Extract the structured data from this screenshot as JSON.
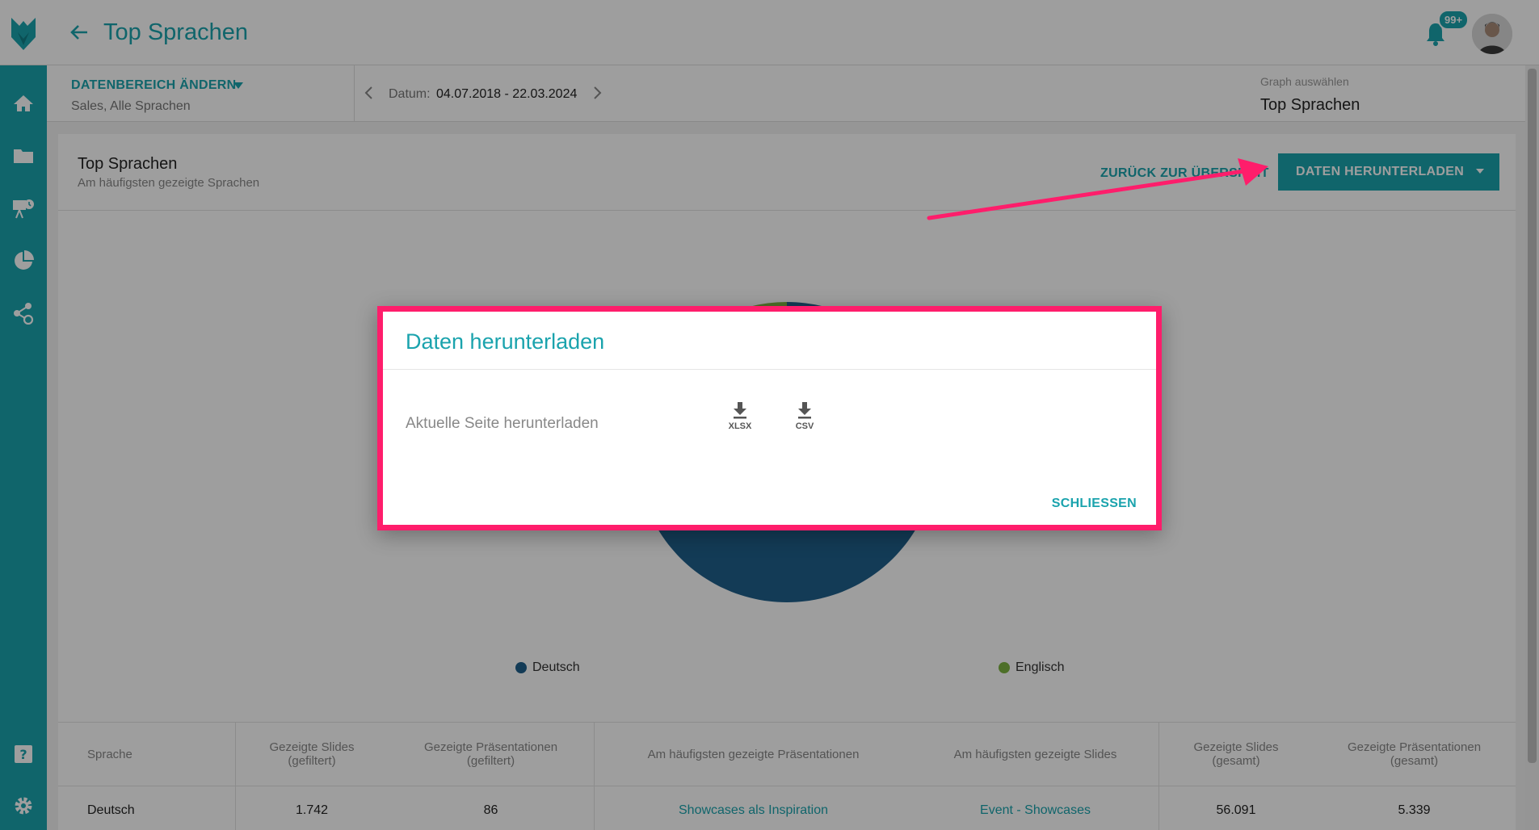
{
  "header": {
    "title": "Top Sprachen",
    "notification_count": "99+"
  },
  "filter": {
    "range_label": "DATENBEREICH ÄNDERN",
    "range_sub": "Sales, Alle Sprachen",
    "date_label": "Datum:",
    "date_value": "04.07.2018 - 22.03.2024",
    "graph_label": "Graph auswählen",
    "graph_value": "Top Sprachen"
  },
  "card": {
    "title": "Top Sprachen",
    "subtitle": "Am häufigsten gezeigte Sprachen",
    "back_overview": "ZURÜCK ZUR ÜBERSICHT",
    "download_button": "DATEN HERUNTERLADEN"
  },
  "chart_data": {
    "type": "pie",
    "categories": [
      "Deutsch",
      "Englisch"
    ],
    "values": [
      96,
      4
    ],
    "colors": [
      "#1f5f8b",
      "#7cb342"
    ]
  },
  "legend": [
    {
      "label": "Deutsch",
      "color": "#1f5f8b"
    },
    {
      "label": "Englisch",
      "color": "#7cb342"
    }
  ],
  "table": {
    "headers": [
      "Sprache",
      "Gezeigte Slides (gefiltert)",
      "Gezeigte Präsentationen (gefiltert)",
      "Am häufigsten gezeigte Präsentationen",
      "Am häufigsten gezeigte Slides",
      "Gezeigte Slides (gesamt)",
      "Gezeigte Präsentationen (gesamt)"
    ],
    "rows": [
      [
        "Deutsch",
        "1.742",
        "86",
        "Showcases als Inspiration",
        "Event - Showcases",
        "56.091",
        "5.339"
      ]
    ]
  },
  "modal": {
    "title": "Daten herunterladen",
    "row_label": "Aktuelle Seite herunterladen",
    "xlsx_label": "XLSX",
    "csv_label": "CSV",
    "close_label": "SCHLIESSEN"
  },
  "colors": {
    "accent": "#1aa3ad",
    "highlight": "#ff1d6b"
  }
}
